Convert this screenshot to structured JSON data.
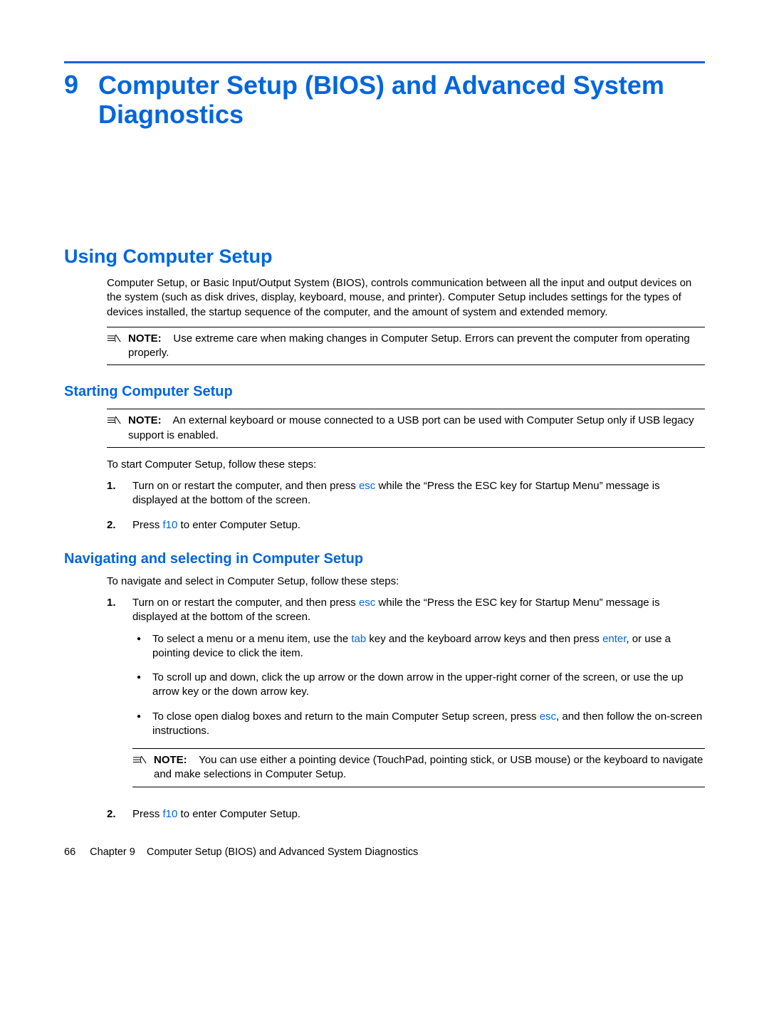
{
  "chapter": {
    "number": "9",
    "title": "Computer Setup (BIOS) and Advanced System Diagnostics"
  },
  "section1": {
    "heading": "Using Computer Setup",
    "intro": "Computer Setup, or Basic Input/Output System (BIOS), controls communication between all the input and output devices on the system (such as disk drives, display, keyboard, mouse, and printer). Computer Setup includes settings for the types of devices installed, the startup sequence of the computer, and the amount of system and extended memory.",
    "note1_label": "NOTE:",
    "note1_text": "Use extreme care when making changes in Computer Setup. Errors can prevent the computer from operating properly."
  },
  "section2": {
    "heading": "Starting Computer Setup",
    "note_label": "NOTE:",
    "note_text": "An external keyboard or mouse connected to a USB port can be used with Computer Setup only if USB legacy support is enabled.",
    "lead": "To start Computer Setup, follow these steps:",
    "steps": [
      {
        "num": "1.",
        "pre": "Turn on or restart the computer, and then press ",
        "key": "esc",
        "post": " while the “Press the ESC key for Startup Menu” message is displayed at the bottom of the screen."
      },
      {
        "num": "2.",
        "pre": "Press ",
        "key": "f10",
        "post": " to enter Computer Setup."
      }
    ]
  },
  "section3": {
    "heading": "Navigating and selecting in Computer Setup",
    "lead": "To navigate and select in Computer Setup, follow these steps:",
    "step1": {
      "num": "1.",
      "pre": "Turn on or restart the computer, and then press ",
      "key": "esc",
      "post": " while the “Press the ESC key for Startup Menu” message is displayed at the bottom of the screen."
    },
    "bullets": {
      "b1_pre": "To select a menu or a menu item, use the ",
      "b1_key1": "tab",
      "b1_mid": " key and the keyboard arrow keys and then press ",
      "b1_key2": "enter",
      "b1_post": ", or use a pointing device to click the item.",
      "b2": "To scroll up and down, click the up arrow or the down arrow in the upper-right corner of the screen, or use the up arrow key or the down arrow key.",
      "b3_pre": "To close open dialog boxes and return to the main Computer Setup screen, press ",
      "b3_key": "esc",
      "b3_post": ", and then follow the on-screen instructions."
    },
    "note_label": "NOTE:",
    "note_text": "You can use either a pointing device (TouchPad, pointing stick, or USB mouse) or the keyboard to navigate and make selections in Computer Setup.",
    "step2": {
      "num": "2.",
      "pre": "Press ",
      "key": "f10",
      "post": " to enter Computer Setup."
    }
  },
  "footer": {
    "page_number": "66",
    "chapter_label": "Chapter 9",
    "chapter_title": "Computer Setup (BIOS) and Advanced System Diagnostics"
  }
}
